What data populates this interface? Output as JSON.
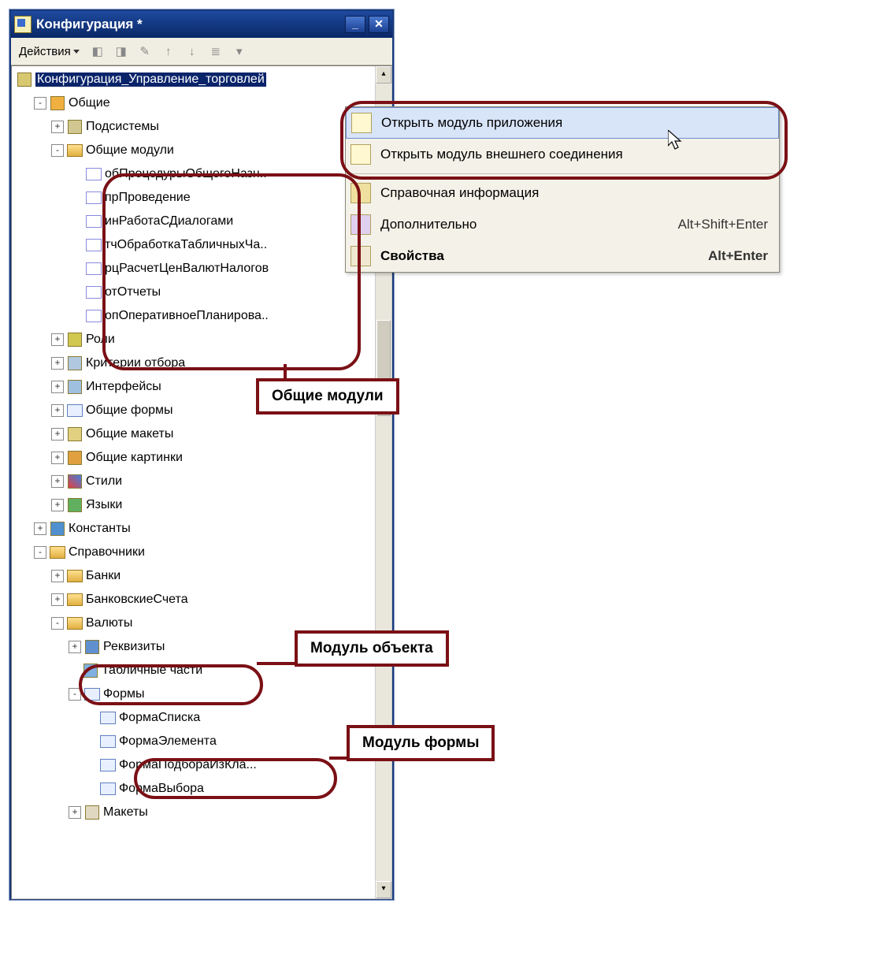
{
  "window": {
    "title": "Конфигурация *"
  },
  "toolbar": {
    "actions_label": "Действия"
  },
  "tree": {
    "root": "Конфигурация_Управление_торговлей",
    "common": {
      "label": "Общие",
      "subsystems": "Подсистемы",
      "common_modules": {
        "label": "Общие модули",
        "items": [
          "обПроцедурыОбщегоНазн..",
          "прПроведение",
          "инРаботаСДиалогами",
          "тчОбработкаТабличныхЧа..",
          "рцРасчетЦенВалютНалогов",
          "отОтчеты",
          "опОперативноеПланирова.."
        ]
      },
      "roles": "Роли",
      "selection_criteria": "Критерии отбора",
      "interfaces": "Интерфейсы",
      "common_forms": "Общие формы",
      "common_templates": "Общие макеты",
      "common_pictures": "Общие картинки",
      "styles": "Стили",
      "languages": "Языки"
    },
    "constants": "Константы",
    "catalogs": {
      "label": "Справочники",
      "banks": "Банки",
      "bank_accounts": "БанковскиеСчета",
      "currencies": {
        "label": "Валюты",
        "attributes": "Реквизиты",
        "tabular": "Табличные части",
        "forms": {
          "label": "Формы",
          "items": [
            "ФормаСписка",
            "ФормаЭлемента",
            "ФормаПодбораИзКла...",
            "ФормаВыбора"
          ]
        },
        "templates": "Макеты"
      }
    }
  },
  "context_menu": {
    "open_app_module": "Открыть модуль приложения",
    "open_ext_connection": "Открыть модуль внешнего соединения",
    "help_info": "Справочная информация",
    "additional": "Дополнительно",
    "additional_shortcut": "Alt+Shift+Enter",
    "properties": "Свойства",
    "properties_shortcut": "Alt+Enter"
  },
  "callouts": {
    "common_modules": "Общие модули",
    "object_module": "Модуль объекта",
    "form_module": "Модуль формы"
  }
}
